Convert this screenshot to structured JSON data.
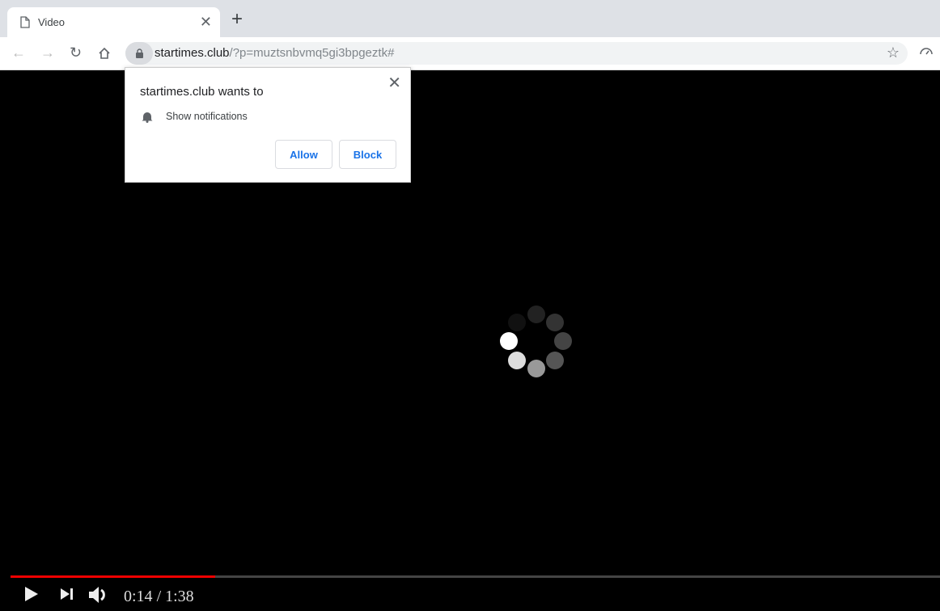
{
  "tab": {
    "title": "Video"
  },
  "address": {
    "host": "startimes.club",
    "path": "/?p=muztsnbvmq5gi3bpgeztk#"
  },
  "popup": {
    "title": "startimes.club wants to",
    "permission": "Show notifications",
    "allow": "Allow",
    "block": "Block"
  },
  "player": {
    "current_time": "0:14",
    "separator": " / ",
    "duration": "1:38",
    "progress_fraction": 0.22,
    "progress_color": "#ee0000"
  }
}
